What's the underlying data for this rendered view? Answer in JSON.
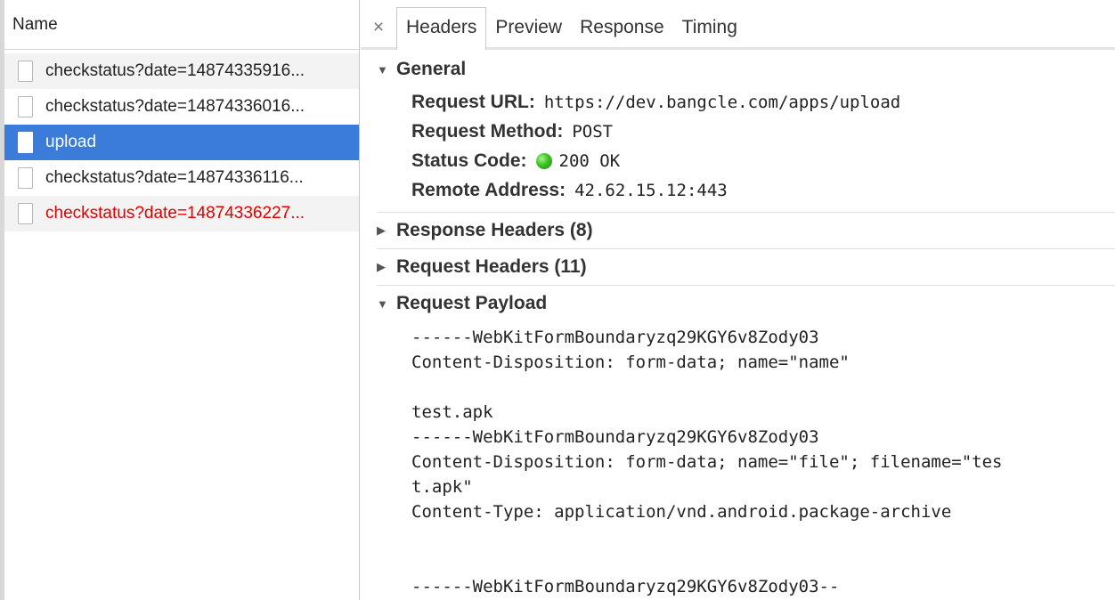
{
  "left": {
    "header": "Name",
    "requests": [
      {
        "name": "checkstatus?date=14874335916...",
        "state": "zebra"
      },
      {
        "name": "checkstatus?date=14874336016...",
        "state": "normal"
      },
      {
        "name": "upload",
        "state": "selected"
      },
      {
        "name": "checkstatus?date=14874336116...",
        "state": "normal"
      },
      {
        "name": "checkstatus?date=14874336227...",
        "state": "error"
      }
    ]
  },
  "tabs": {
    "close_glyph": "×",
    "items": [
      "Headers",
      "Preview",
      "Response",
      "Timing"
    ],
    "active": "Headers"
  },
  "general": {
    "title": "General",
    "request_url_key": "Request URL:",
    "request_url": "https://dev.bangcle.com/apps/upload",
    "method_key": "Request Method:",
    "method": "POST",
    "status_key": "Status Code:",
    "status": "200 OK",
    "status_color": "#3bc224",
    "remote_key": "Remote Address:",
    "remote": "42.62.15.12:443"
  },
  "response_headers": {
    "title": "Response Headers (8)"
  },
  "request_headers": {
    "title": "Request Headers (11)"
  },
  "payload": {
    "title": "Request Payload",
    "body": "------WebKitFormBoundaryzq29KGY6v8Zody03\nContent-Disposition: form-data; name=\"name\"\n\ntest.apk\n------WebKitFormBoundaryzq29KGY6v8Zody03\nContent-Disposition: form-data; name=\"file\"; filename=\"tes\nt.apk\"\nContent-Type: application/vnd.android.package-archive\n\n\n------WebKitFormBoundaryzq29KGY6v8Zody03--"
  },
  "colors": {
    "selected_row": "#3b7bd9",
    "error_text": "#e10000"
  }
}
